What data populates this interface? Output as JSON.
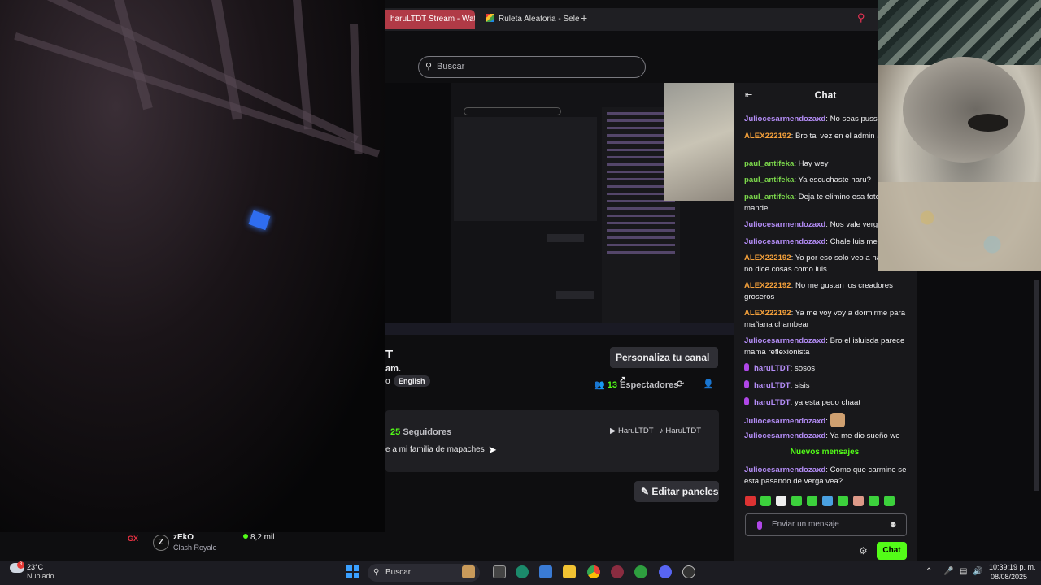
{
  "browser": {
    "tabs": [
      {
        "label": "haruLTDT Stream - Watc"
      },
      {
        "label": "Ruleta Aleatoria - Selector"
      }
    ],
    "new_tab": "+",
    "search_placeholder": "Buscar"
  },
  "channel": {
    "name": "T",
    "subtitle": "am.",
    "subtitle_prefix": "o",
    "language": "English",
    "personaliza_label": "Personaliza tu canal",
    "viewers_count": "13",
    "viewers_label": "Espectadores",
    "followers_count": "25",
    "followers_label": "Seguidores",
    "social_youtube": "HaruLTDT",
    "social_tiktok": "HaruLTDT",
    "about_text": "e a mi familia de mapaches",
    "edit_panels_label": "Editar paneles"
  },
  "chat": {
    "title": "Chat",
    "messages": [
      {
        "user": "Juliocesarmendozaxd",
        "text": "No seas pussy w",
        "color": "julio"
      },
      {
        "user": "ALEX222192",
        "text": "Bro tal vez en el admin ab estare",
        "color": "alex"
      },
      {
        "user": "paul_antifeka",
        "text": "Hay wey",
        "color": "paul"
      },
      {
        "user": "paul_antifeka",
        "text": "Ya escuchaste haru?",
        "color": "paul"
      },
      {
        "user": "paul_antifeka",
        "text": "Deja te elimino esa foto q mande",
        "color": "paul"
      },
      {
        "user": "Juliocesarmendozaxd",
        "text": "Nos vale verga l",
        "color": "julio"
      },
      {
        "user": "Juliocesarmendozaxd",
        "text": "Chale luis me de",
        "color": "julio"
      },
      {
        "user": "ALEX222192",
        "text": "Yo por eso solo veo a har porque no dice cosas como luis",
        "color": "alex"
      },
      {
        "user": "ALEX222192",
        "text": "No me gustan los creadores groseros",
        "color": "alex"
      },
      {
        "user": "ALEX222192",
        "text": "Ya me voy voy a dormirme para mañana chambear",
        "color": "alex"
      },
      {
        "user": "Juliocesarmendozaxd",
        "text": "Bro el isluisda parece mama reflexionista",
        "color": "julio"
      },
      {
        "user": "haruLTDT",
        "text": "sosos",
        "color": "haru"
      },
      {
        "user": "haruLTDT",
        "text": "sisis",
        "color": "haru"
      },
      {
        "user": "haruLTDT",
        "text": "ya esta pedo chaat",
        "color": "haru"
      },
      {
        "user": "Juliocesarmendozaxd",
        "text": "",
        "color": "julio"
      },
      {
        "user": "Juliocesarmendozaxd",
        "text": "Ya me dio sueño we",
        "color": "julio"
      }
    ],
    "new_messages_label": "Nuevos mensajes",
    "new_message": {
      "user": "Juliocesarmendozaxd",
      "text": "Como que carmine se esta pasando de verga vea?"
    },
    "input_placeholder": "Enviar un mensaje",
    "send_label": "Chat"
  },
  "stream_strip": {
    "gx": "GX",
    "avatar_letter": "Z",
    "streamer": "zEkO",
    "game": "Clash Royale",
    "viewers": "8,2 mil"
  },
  "taskbar": {
    "weather_badge": "8",
    "temperature": "23°C",
    "weather": "Nublado",
    "search_label": "Buscar",
    "time": "10:39:19 p. m.",
    "date": "08/08/2025"
  }
}
